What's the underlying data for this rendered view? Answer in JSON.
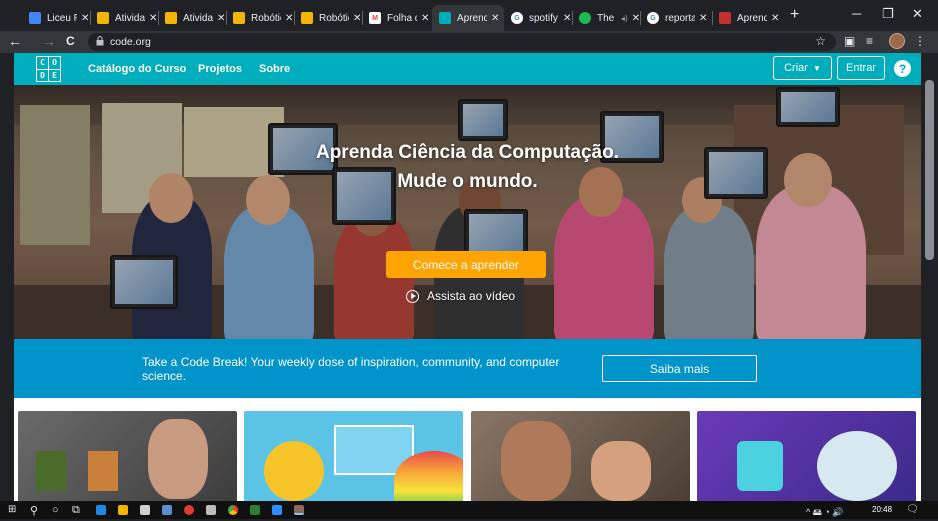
{
  "browser": {
    "tabs": [
      {
        "title": "Liceu P",
        "favicon_color": "#4285f4",
        "favicon": "drive-icon"
      },
      {
        "title": "Atividad",
        "favicon_color": "#f4b400",
        "favicon": "slides-icon"
      },
      {
        "title": "Atividad",
        "favicon_color": "#f4b400",
        "favicon": "slides-icon"
      },
      {
        "title": "Robótic",
        "favicon_color": "#f4b400",
        "favicon": "slides-icon"
      },
      {
        "title": "Robótic",
        "favicon_color": "#f4b400",
        "favicon": "slides-icon"
      },
      {
        "title": "Folha d",
        "favicon_color": "#ea4335",
        "favicon": "gmail-icon"
      },
      {
        "title": "Aprend",
        "favicon_color": "#00adbc",
        "favicon": "code-org-icon",
        "active": true
      },
      {
        "title": "spotify",
        "favicon_color": "#ffffff",
        "favicon": "google-icon"
      },
      {
        "title": "The",
        "favicon_color": "#1db954",
        "favicon": "spotify-icon"
      },
      {
        "title": "reporta",
        "favicon_color": "#ffffff",
        "favicon": "google-icon"
      },
      {
        "title": "Aprend",
        "favicon_color": "#c4302b",
        "favicon": "ytk-icon"
      }
    ],
    "close_glyph": "✕",
    "new_tab": "+",
    "window_controls": {
      "minimize": "─",
      "maximize": "❐",
      "close": "✕"
    },
    "nav": {
      "back": "←",
      "forward": "→",
      "reload": "C"
    },
    "lock_glyph": "🔒",
    "url": "code.org",
    "star_glyph": "☆",
    "menu_glyph": "⋮"
  },
  "site": {
    "logo": [
      "C",
      "O",
      "D",
      "E"
    ],
    "nav_links": [
      "Catálogo do Curso",
      "Projetos",
      "Sobre"
    ],
    "create_label": "Criar",
    "create_caret": "▼",
    "signin_label": "Entrar",
    "help_glyph": "?",
    "hero": {
      "line1": "Aprenda Ciência da Computação.",
      "line2": "Mude o mundo.",
      "cta": "Comece a aprender",
      "video": "Assista ao vídeo"
    },
    "banner": {
      "text": "Take a Code Break! Your weekly dose of inspiration, community, and computer science.",
      "button": "Saiba mais"
    }
  },
  "taskbar": {
    "clock": "20:48",
    "tray_glyphs": "^ 🖴 ◔ 🔊"
  }
}
